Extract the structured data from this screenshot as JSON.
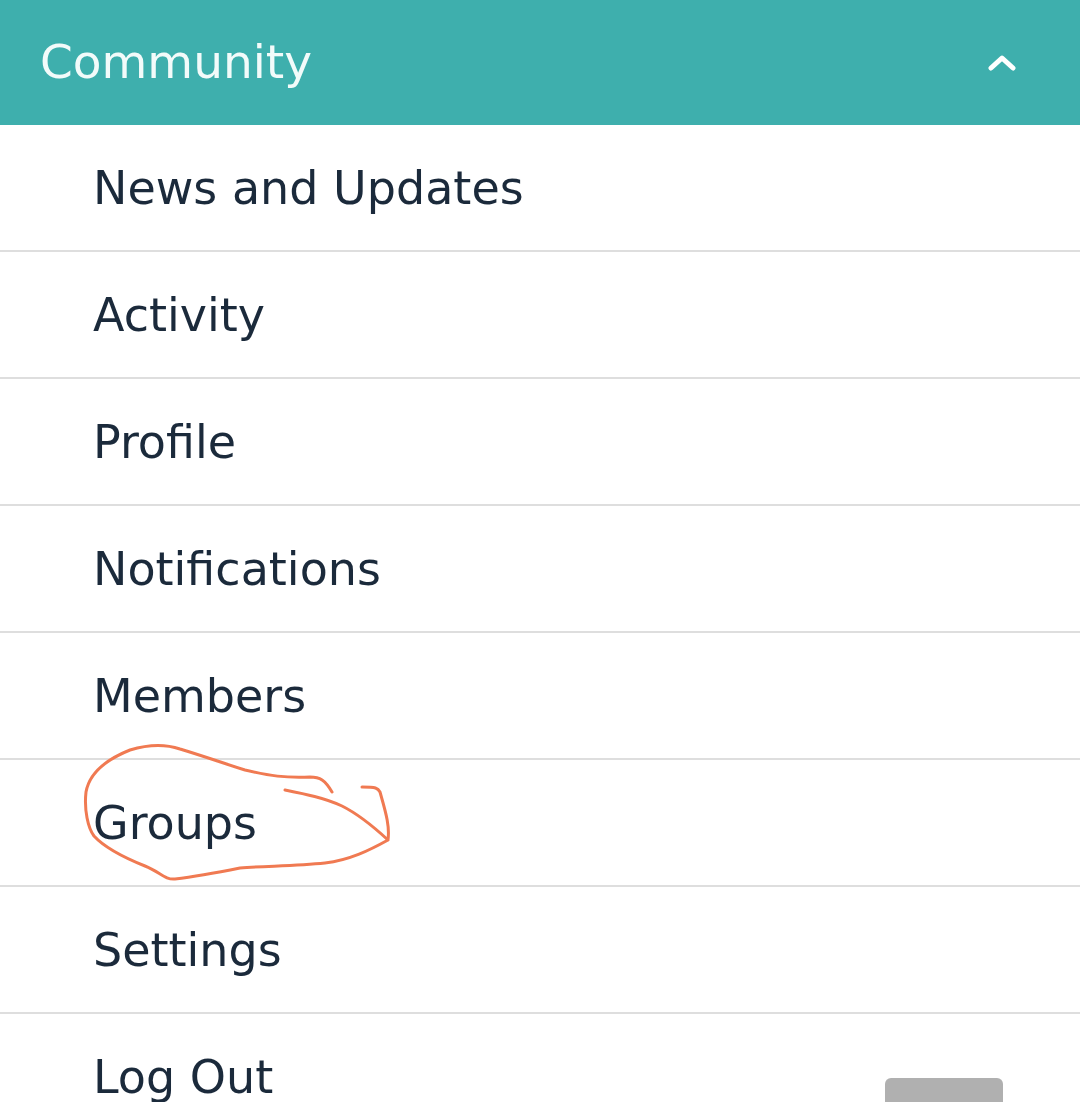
{
  "header": {
    "title": "Community",
    "expanded": true
  },
  "items": [
    {
      "label": "News and Updates",
      "circled": false
    },
    {
      "label": "Activity",
      "circled": false
    },
    {
      "label": "Profile",
      "circled": false
    },
    {
      "label": "Notifications",
      "circled": false
    },
    {
      "label": "Members",
      "circled": false
    },
    {
      "label": "Groups",
      "circled": true
    },
    {
      "label": "Settings",
      "circled": false
    },
    {
      "label": "Log Out",
      "circled": false
    }
  ]
}
